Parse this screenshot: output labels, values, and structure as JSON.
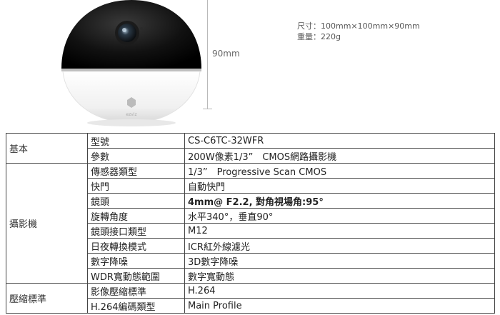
{
  "hero": {
    "dimension_height_label": "90mm",
    "size_line": "尺寸：100mm×100mm×90mm",
    "weight_line": "重量：220g"
  },
  "specs": {
    "groups": [
      {
        "group": "基本",
        "rows": [
          {
            "label": "型號",
            "value": "CS-C6TC-32WFR"
          },
          {
            "label": "參數",
            "value": "200W像素1/3”　CMOS網路攝影機"
          }
        ]
      },
      {
        "group": "攝影機",
        "rows": [
          {
            "label": "傳感器類型",
            "value": "1/3”　Progressive Scan CMOS"
          },
          {
            "label": "快門",
            "value": "自動快門"
          },
          {
            "label": "鏡頭",
            "value": "4mm@ F2.2, 對角視場角:95°"
          },
          {
            "label": "旋轉角度",
            "value": "水平340°，垂直90°"
          },
          {
            "label": "鏡頭接口類型",
            "value": "M12"
          },
          {
            "label": "日夜轉換模式",
            "value": "ICR紅外線濾光"
          },
          {
            "label": "數字降噪",
            "value": "3D數字降噪"
          },
          {
            "label": "WDR寬動態範圍",
            "value": "數字寬動態"
          }
        ]
      },
      {
        "group": "壓縮標準",
        "rows": [
          {
            "label": "影像壓縮標準",
            "value": "H.264"
          },
          {
            "label": "H.264編碼類型",
            "value": "Main Profile"
          }
        ]
      }
    ]
  }
}
